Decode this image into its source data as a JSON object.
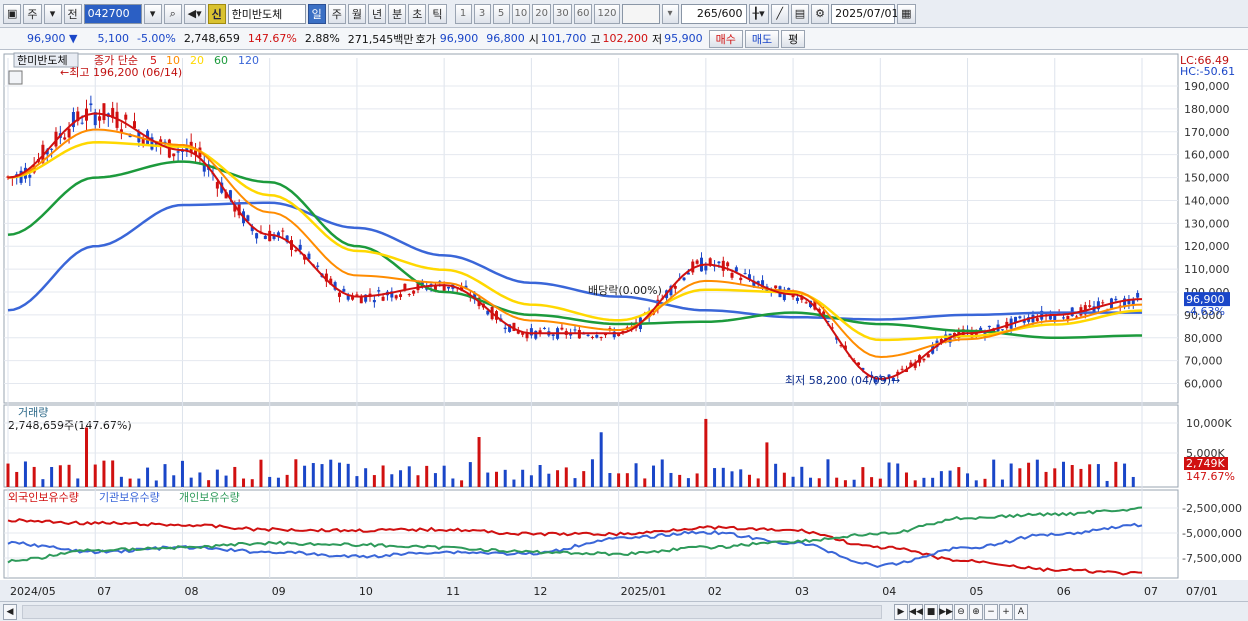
{
  "toolbar": {
    "period_unit": "주",
    "period_dropdown": "▾",
    "prev_label": "전",
    "stock_code": "042700",
    "stock_name": "한미반도체",
    "new_badge": "신",
    "period_buttons": [
      {
        "label": "일",
        "active": true
      },
      {
        "label": "주",
        "active": false
      },
      {
        "label": "월",
        "active": false
      },
      {
        "label": "년",
        "active": false
      },
      {
        "label": "분",
        "active": false
      },
      {
        "label": "초",
        "active": false
      },
      {
        "label": "틱",
        "active": false
      }
    ],
    "interval_buttons": [
      "1",
      "3",
      "5",
      "10",
      "20",
      "30",
      "60",
      "120"
    ],
    "count_value": "265",
    "count_max": "/600",
    "date_value": "2025/07/01"
  },
  "quote": {
    "price": "96,900",
    "direction": "▼",
    "change": "5,100",
    "change_pct": "-5.00%",
    "volume": "2,748,659",
    "volume_ratio": "147.67%",
    "turnover": "2.88%",
    "amount": "271,545백만",
    "hoga_label": "호가",
    "ask": "96,900",
    "bid": "96,800",
    "open_label": "시",
    "open": "101,700",
    "high_label": "고",
    "high": "102,200",
    "low_label": "저",
    "low": "95,900",
    "buy_label": "매수",
    "sell_label": "매도",
    "eval_label": "평"
  },
  "price_panel": {
    "stock_name": "한미반도체",
    "legend_prefix": "종가 단순",
    "ma_periods": [
      "5",
      "10",
      "20",
      "60",
      "120"
    ],
    "high_annotation": "←최고 196,200 (06/14)",
    "low_annotation": "최저 58,200 (04/09)→",
    "dividend_annotation": "배당락(0.00%)",
    "lc_label": "LC:66.49",
    "hc_label": "HC:-50.61",
    "current_tag": "96,900",
    "current_pct": "-4.63%",
    "y_ticks": [
      "190,000",
      "180,000",
      "170,000",
      "160,000",
      "150,000",
      "140,000",
      "130,000",
      "120,000",
      "110,000",
      "100,000",
      "90,000",
      "80,000",
      "70,000",
      "60,000"
    ]
  },
  "volume_panel": {
    "title": "거래량",
    "value_label": "2,748,659주(147.67%)",
    "y_ticks": [
      "10,000K",
      "5,000K"
    ],
    "current_tag": "2,749K",
    "current_pct": "147.67%"
  },
  "holdings_panel": {
    "legend": [
      "외국인보유수량",
      "기관보유수량",
      "개인보유수량"
    ],
    "y_ticks": [
      "-2,500,000",
      "-5,000,000",
      "-7,500,000"
    ]
  },
  "x_axis": {
    "labels": [
      "2024/05",
      "07",
      "08",
      "09",
      "10",
      "11",
      "12",
      "2025/01",
      "02",
      "03",
      "04",
      "05",
      "06",
      "07"
    ],
    "right_label": "07/01"
  },
  "colors": {
    "up": "#d01010",
    "down": "#1a46c8",
    "ma5": "#d01010",
    "ma10": "#ff8c00",
    "ma20": "#ffd800",
    "ma60": "#1c9a3c",
    "ma120": "#3a66d8",
    "foreign": "#d01010",
    "inst": "#3a66d8",
    "indiv": "#2e9a5a"
  },
  "statusbar": {
    "icons": [
      "play-icon",
      "prev-icon",
      "stop-icon",
      "next-icon",
      "zoom-out-icon",
      "zoom-in-icon",
      "minus-icon",
      "plus-icon",
      "font-icon"
    ]
  },
  "chart_data": {
    "type": "line",
    "title": "한미반도체",
    "x": [
      "2024/05",
      "07",
      "08",
      "09",
      "10",
      "11",
      "12",
      "2025/01",
      "02",
      "03",
      "04",
      "05",
      "06",
      "07"
    ],
    "ylim": [
      55000,
      197000
    ],
    "series": [
      {
        "name": "종가",
        "values": [
          150000,
          178000,
          162000,
          125000,
          98000,
          103000,
          82000,
          82000,
          112000,
          99000,
          62000,
          82000,
          90000,
          96900
        ]
      },
      {
        "name": "120",
        "values": [
          92000,
          120000,
          138000,
          139000,
          128000,
          116000,
          104000,
          98000,
          92000,
          89000,
          88000,
          90000,
          91000,
          91000
        ]
      },
      {
        "name": "60",
        "values": [
          125000,
          150000,
          157000,
          148000,
          120000,
          100000,
          90000,
          86000,
          87000,
          91000,
          86000,
          83000,
          80000,
          81000
        ]
      }
    ]
  }
}
